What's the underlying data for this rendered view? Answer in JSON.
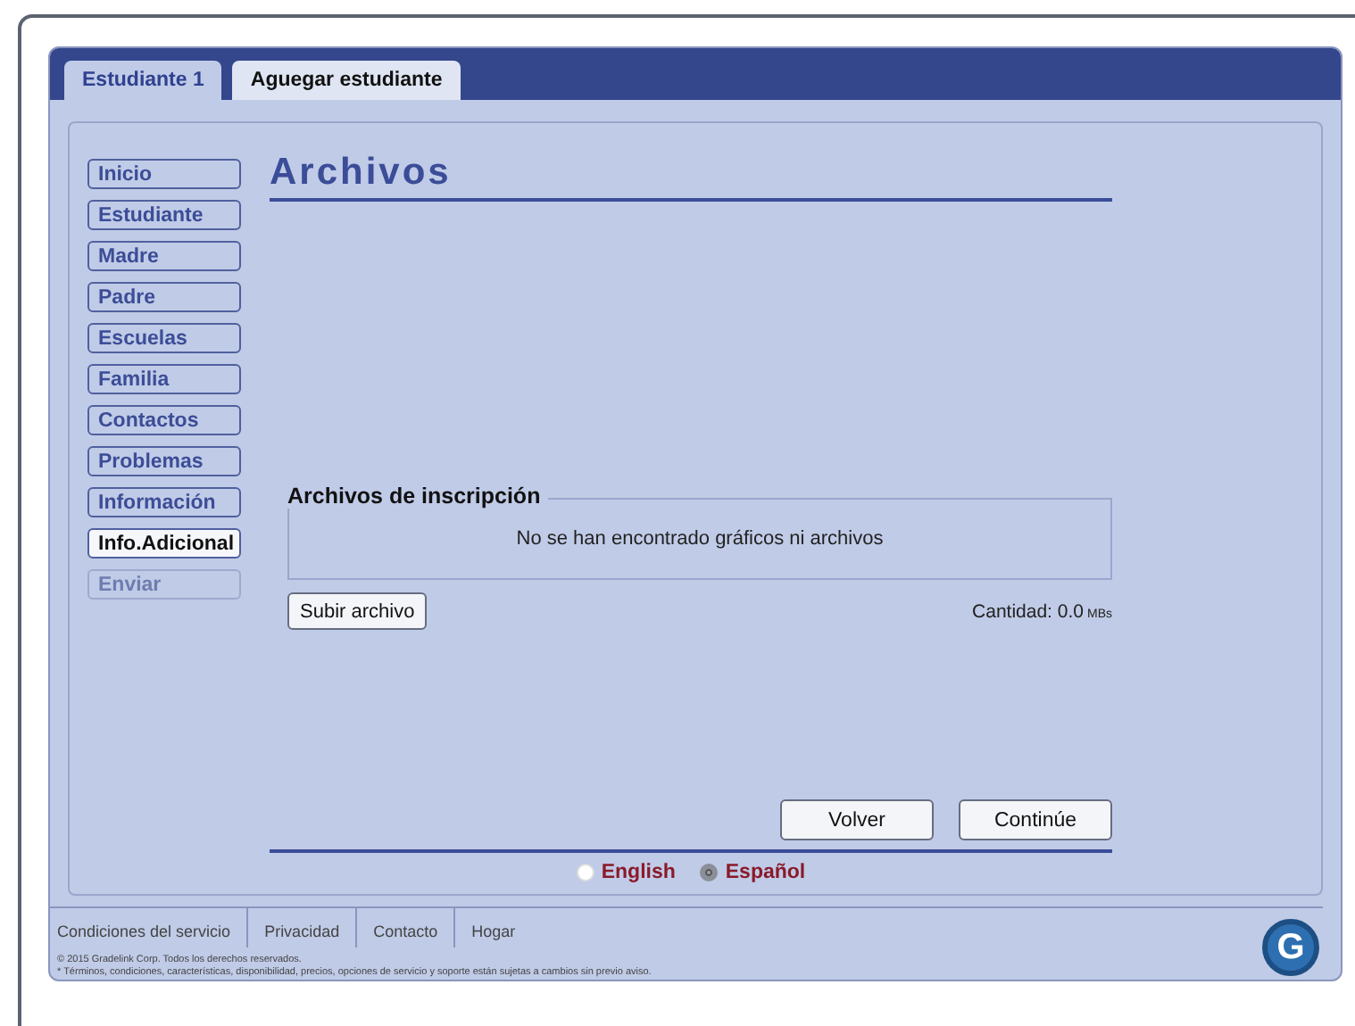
{
  "tabs": [
    {
      "label": "Estudiante 1",
      "selected": true
    },
    {
      "label": "Aguegar estudiante",
      "selected": false
    }
  ],
  "sidebar": {
    "items": [
      {
        "label": "Inicio",
        "selected": false,
        "disabled": false
      },
      {
        "label": "Estudiante",
        "selected": false,
        "disabled": false
      },
      {
        "label": "Madre",
        "selected": false,
        "disabled": false
      },
      {
        "label": "Padre",
        "selected": false,
        "disabled": false
      },
      {
        "label": "Escuelas",
        "selected": false,
        "disabled": false
      },
      {
        "label": "Familia",
        "selected": false,
        "disabled": false
      },
      {
        "label": "Contactos",
        "selected": false,
        "disabled": false
      },
      {
        "label": "Problemas",
        "selected": false,
        "disabled": false
      },
      {
        "label": "Información",
        "selected": false,
        "disabled": false
      },
      {
        "label": "Info.Adicional",
        "selected": true,
        "disabled": false
      },
      {
        "label": "Enviar",
        "selected": false,
        "disabled": true
      }
    ]
  },
  "heading": "Archivos",
  "files": {
    "legend": "Archivos de inscripción",
    "empty_message": "No se han encontrado gráficos ni archivos",
    "upload_button": "Subir archivo",
    "total": "Cantidad: 0.0",
    "total_unit": "MBs"
  },
  "buttons": [
    "Volver",
    "Continúe"
  ],
  "languages": [
    {
      "label": "English",
      "selected": false
    },
    {
      "label": "Español",
      "selected": true
    }
  ],
  "footer": {
    "links": [
      "Condiciones del servicio",
      "Privacidad",
      "Contacto",
      "Hogar"
    ],
    "copyright": "© 2015 Gradelink Corp. Todos los derechos reservados.",
    "disclaimer": "* Términos, condiciones, características, disponibilidad, precios, opciones de servicio y soporte están sujetas a cambios sin previo aviso.",
    "logo_letter": "G"
  }
}
